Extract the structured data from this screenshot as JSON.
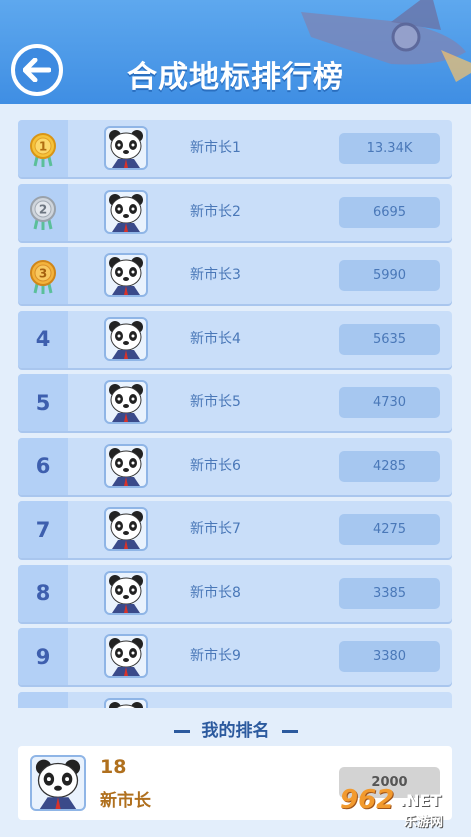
{
  "header": {
    "title": "合成地标排行榜",
    "back_icon": "arrow-left-icon"
  },
  "leaderboard": [
    {
      "rank": "1",
      "medal": "gold",
      "name": "新市长1",
      "score": "13.34K"
    },
    {
      "rank": "2",
      "medal": "silver",
      "name": "新市长2",
      "score": "6695"
    },
    {
      "rank": "3",
      "medal": "bronze",
      "name": "新市长3",
      "score": "5990"
    },
    {
      "rank": "4",
      "medal": "",
      "name": "新市长4",
      "score": "5635"
    },
    {
      "rank": "5",
      "medal": "",
      "name": "新市长5",
      "score": "4730"
    },
    {
      "rank": "6",
      "medal": "",
      "name": "新市长6",
      "score": "4285"
    },
    {
      "rank": "7",
      "medal": "",
      "name": "新市长7",
      "score": "4275"
    },
    {
      "rank": "8",
      "medal": "",
      "name": "新市长8",
      "score": "3385"
    },
    {
      "rank": "9",
      "medal": "",
      "name": "新市长9",
      "score": "3380"
    },
    {
      "rank": "",
      "medal": "",
      "name": "",
      "score": ""
    }
  ],
  "my_rank": {
    "title": "我的排名",
    "rank": "18",
    "name": "新市长",
    "score": "2000"
  },
  "watermark": {
    "main": "962",
    "net": ".NET",
    "sub": "乐游网"
  },
  "colors": {
    "header": "#4a9ae8",
    "background": "#e3eefb",
    "row": "#c9def9",
    "rank_text": "#3e5fae",
    "my_text": "#b0701e"
  }
}
